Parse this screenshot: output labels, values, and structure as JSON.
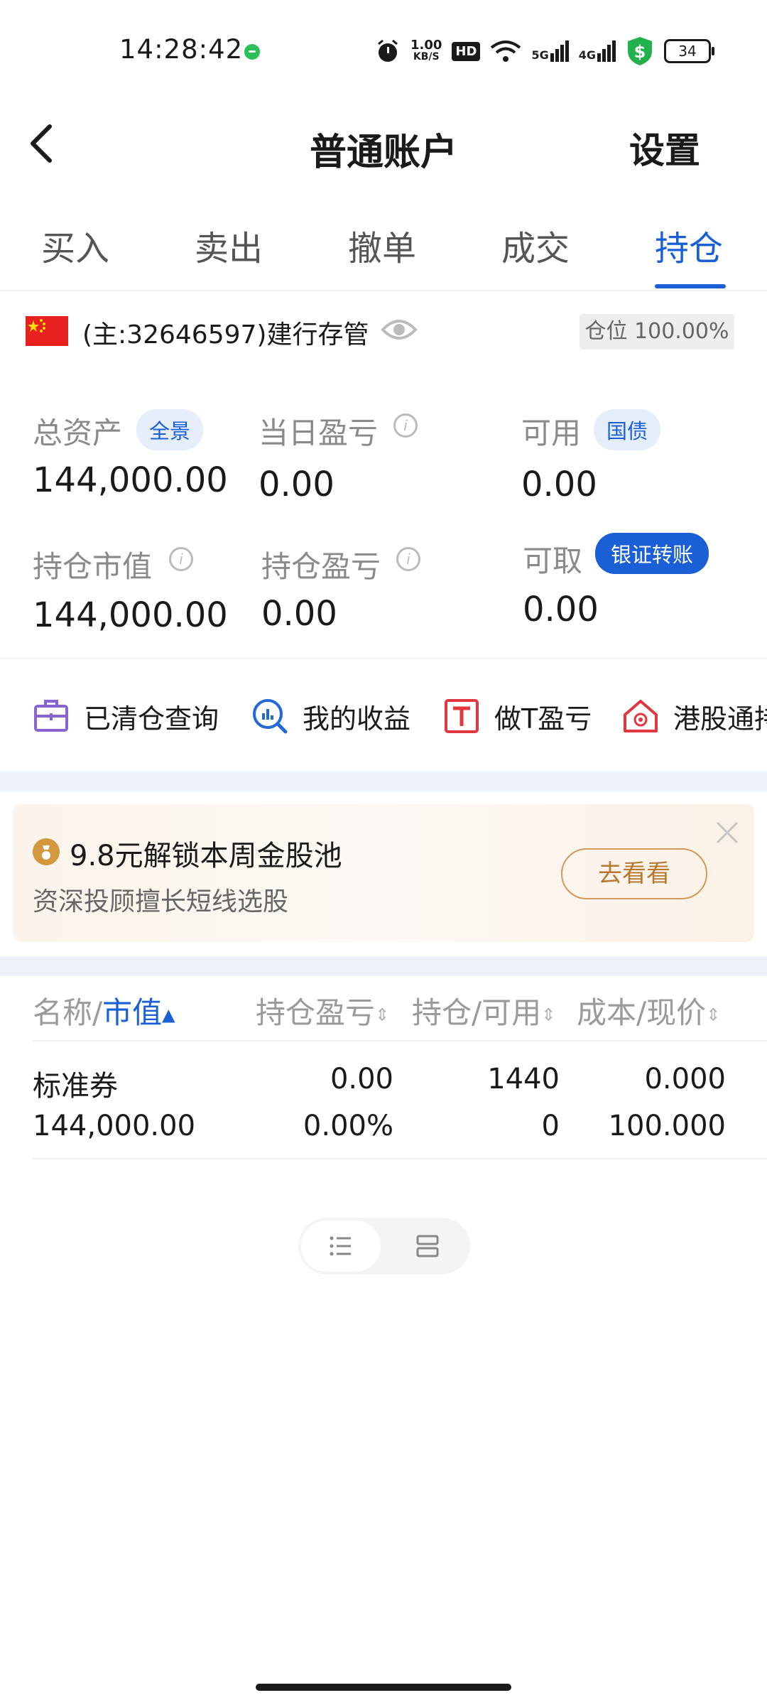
{
  "status_bar": {
    "time": "14:28:42",
    "net_speed_value": "1.00",
    "net_speed_unit": "KB/S",
    "hd_label": "HD",
    "signal_1": "5G",
    "signal_2": "4G",
    "battery": "34"
  },
  "header": {
    "title": "普通账户",
    "settings_label": "设置"
  },
  "tabs": [
    "买入",
    "卖出",
    "撤单",
    "成交",
    "持仓"
  ],
  "active_tab_index": 4,
  "account": {
    "name": "(主:32646597)建行存管",
    "position_badge": "仓位 100.00%"
  },
  "summary": {
    "total_assets_label": "总资产",
    "panorama_chip": "全景",
    "total_assets": "144,000.00",
    "daily_pl_label": "当日盈亏",
    "daily_pl": "0.00",
    "available_label": "可用",
    "treasury_chip": "国债",
    "available": "0.00",
    "market_value_label": "持仓市值",
    "market_value": "144,000.00",
    "position_pl_label": "持仓盈亏",
    "position_pl": "0.00",
    "withdrawable_label": "可取",
    "bank_transfer_button": "银证转账",
    "withdrawable": "0.00"
  },
  "quick_links": {
    "cleared": "已清仓查询",
    "earnings": "我的收益",
    "t_trade": "做T盈亏",
    "hk_connect": "港股通持"
  },
  "promo": {
    "title": "9.8元解锁本周金股池",
    "subtitle": "资深投顾擅长短线选股",
    "button": "去看看"
  },
  "table": {
    "headers": {
      "name_part": "名称/",
      "value_part": "市值",
      "position_pl": "持仓盈亏",
      "holding": "持仓/可用",
      "cost": "成本/现价"
    },
    "rows": [
      {
        "name": "标准券",
        "market_value": "144,000.00",
        "pl": "0.00",
        "pl_pct": "0.00%",
        "holding": "1440",
        "available": "0",
        "cost": "0.000",
        "price": "100.000"
      }
    ]
  },
  "colors": {
    "accent": "#1b5fd6",
    "promo_accent": "#d29a5a"
  }
}
